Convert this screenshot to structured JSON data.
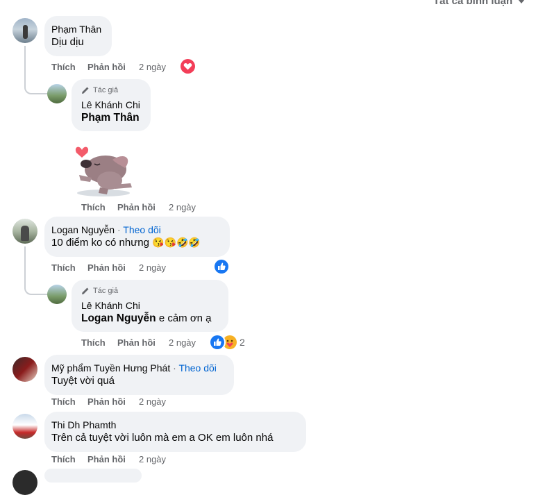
{
  "filter": {
    "label": "Tất cả bình luận"
  },
  "actions": {
    "like": "Thích",
    "reply": "Phản hồi"
  },
  "comments": [
    {
      "name": "Phạm Thân",
      "text": "Dịu dịu",
      "time": "2 ngày",
      "reply": {
        "author_badge": "Tác giả",
        "name": "Lê Khánh Chi",
        "mention": "Phạm Thân",
        "time": "2 ngày"
      }
    },
    {
      "name": "Logan Nguyễn",
      "follow": "Theo dõi",
      "text": "10 điểm ko có nhưng",
      "emojis": "😘😘🤣🤣",
      "time": "2 ngày",
      "reply": {
        "author_badge": "Tác giả",
        "name": "Lê Khánh Chi",
        "mention": "Logan Nguyễn",
        "text": "e cảm ơn ạ",
        "time": "2 ngày",
        "reaction_count": "2"
      }
    },
    {
      "name": "Mỹ phẩm Tuyền Hưng Phát",
      "follow": "Theo dõi",
      "text": "Tuyệt vời quá",
      "time": "2 ngày"
    },
    {
      "name": "Thi Dh Phamth",
      "text": "Trên cả tuyệt vời luôn mà em a OK em luôn nhá",
      "time": "2 ngày"
    }
  ],
  "colors": {
    "link": "#0064d1",
    "bubble": "#f0f2f5",
    "like": "#1877f2",
    "love": "#f33e58"
  },
  "icons": [
    "chevron-down-icon",
    "pencil-icon",
    "like-icon",
    "love-icon",
    "care-icon",
    "sticker-bear-heart"
  ]
}
